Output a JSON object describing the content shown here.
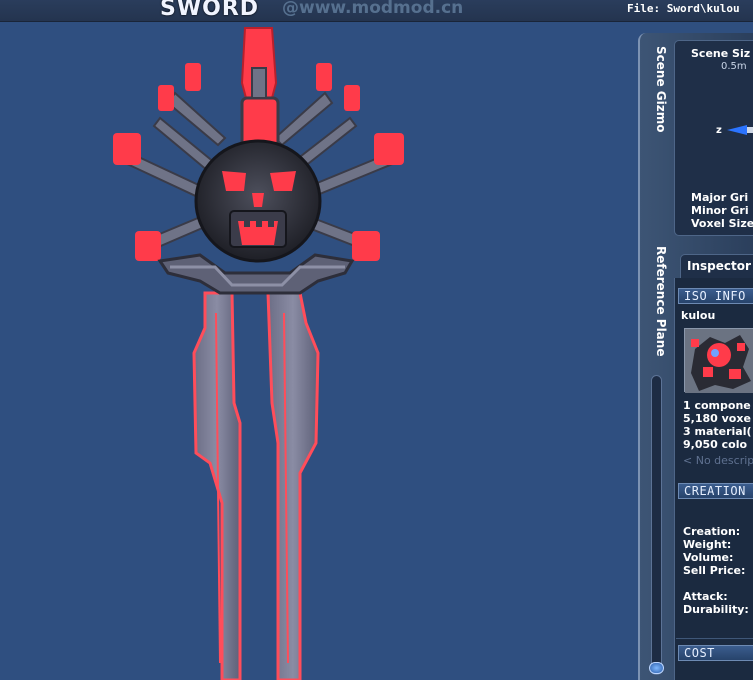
{
  "header": {
    "title": "SWORD",
    "watermark": "@www.modmod.cn",
    "file": "File: Sword\\kulou"
  },
  "side_tabs": {
    "scene_gizmo": "Scene Gizmo",
    "reference_plane": "Reference Plane"
  },
  "gizmo": {
    "scene_size_label": "Scene Siz",
    "scene_size_value": "0.5m",
    "axis_label": "z",
    "major_grid": "Major Gri",
    "minor_grid": "Minor Gri",
    "voxel_size": "Voxel Size"
  },
  "inspector": {
    "tab_label": "Inspector",
    "iso_info_header": "ISO INFO",
    "iso_name": "kulou",
    "stats": [
      "1 compone",
      "5,180 voxe",
      "3 material(",
      "9,050 colo"
    ],
    "description_placeholder": "< No descrip",
    "creation_header": "CREATION",
    "creation_fields": [
      "Creation:",
      "Weight:",
      "Volume:",
      "Sell Price:",
      "Attack:",
      "Durability:"
    ],
    "cost_header": "COST"
  },
  "colors": {
    "background": "#2f4f80",
    "accent_red": "#ff3b4a",
    "metal": "#6f7387"
  },
  "icons": {
    "axis_arrow": "axis-arrow-icon"
  }
}
